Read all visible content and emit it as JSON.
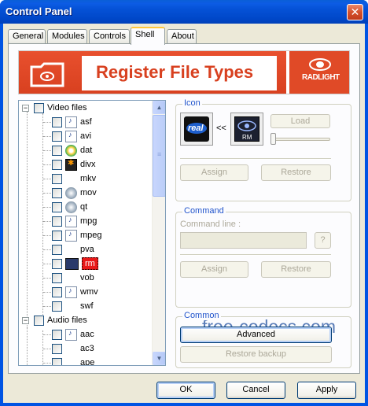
{
  "window": {
    "title": "Control Panel",
    "close_glyph": "✕"
  },
  "tabs": [
    {
      "label": "General"
    },
    {
      "label": "Modules"
    },
    {
      "label": "Controls"
    },
    {
      "label": "Shell",
      "active": true
    },
    {
      "label": "About"
    }
  ],
  "banner": {
    "title": "Register File Types",
    "brand": "RADLIGHT"
  },
  "tree": {
    "groups": [
      {
        "label": "Video files",
        "expanded": true,
        "items": [
          {
            "label": "asf",
            "icon": "doc"
          },
          {
            "label": "avi",
            "icon": "doc"
          },
          {
            "label": "dat",
            "icon": "dat"
          },
          {
            "label": "divx",
            "icon": "divx"
          },
          {
            "label": "mkv",
            "icon": "blank"
          },
          {
            "label": "mov",
            "icon": "qt"
          },
          {
            "label": "qt",
            "icon": "qt"
          },
          {
            "label": "mpg",
            "icon": "doc"
          },
          {
            "label": "mpeg",
            "icon": "doc"
          },
          {
            "label": "pva",
            "icon": "blank"
          },
          {
            "label": "rm",
            "icon": "rm",
            "selected": true
          },
          {
            "label": "vob",
            "icon": "blank"
          },
          {
            "label": "wmv",
            "icon": "doc"
          },
          {
            "label": "swf",
            "icon": "blank"
          }
        ]
      },
      {
        "label": "Audio files",
        "expanded": true,
        "items": [
          {
            "label": "aac",
            "icon": "doc"
          },
          {
            "label": "ac3",
            "icon": "blank"
          },
          {
            "label": "ape",
            "icon": "blank"
          }
        ]
      }
    ]
  },
  "icon_group": {
    "title": "Icon",
    "arrow_text": "<<",
    "current_icon_label": "real",
    "new_icon_label": "RM",
    "load_label": "Load",
    "assign_label": "Assign",
    "restore_label": "Restore"
  },
  "command_group": {
    "title": "Command",
    "command_line_label": "Command line :",
    "command_line_value": "",
    "help_label": "?",
    "assign_label": "Assign",
    "restore_label": "Restore"
  },
  "common_group": {
    "title": "Common",
    "advanced_label": "Advanced",
    "restore_backup_label": "Restore backup"
  },
  "watermark": "free-codecs.com",
  "footer": {
    "ok_label": "OK",
    "cancel_label": "Cancel",
    "apply_label": "Apply"
  },
  "colors": {
    "accent": "#d8401f",
    "selection": "#e81818",
    "group_title": "#2255cc"
  }
}
